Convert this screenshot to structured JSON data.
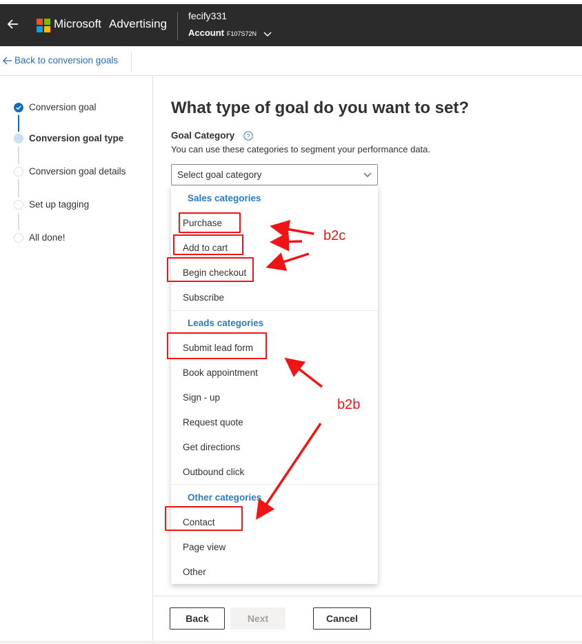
{
  "header": {
    "brand": "Microsoft",
    "product": "Advertising",
    "account_name": "fecify331",
    "account_label": "Account",
    "account_id": "F107S72N",
    "icons": [
      "back-arrow-icon",
      "microsoft-logo-icon",
      "chevron-down-icon"
    ],
    "colors": {
      "bar": "#2b2b2b",
      "logo": [
        "#f25022",
        "#7fba00",
        "#00a4ef",
        "#ffb900"
      ]
    }
  },
  "nav": {
    "back_label": "Back to conversion goals"
  },
  "steps": [
    {
      "label": "Conversion goal",
      "state": "done"
    },
    {
      "label": "Conversion goal type",
      "state": "current"
    },
    {
      "label": "Conversion goal details",
      "state": "pending"
    },
    {
      "label": "Set up tagging",
      "state": "pending"
    },
    {
      "label": "All done!",
      "state": "pending"
    }
  ],
  "main": {
    "title": "What type of goal do you want to set?",
    "category_label": "Goal Category",
    "category_description": "You can use these categories to segment your performance data.",
    "select_placeholder": "Select goal category"
  },
  "dropdown": {
    "groups": [
      {
        "header": "Sales categories",
        "options": [
          "Purchase",
          "Add to cart",
          "Begin checkout",
          "Subscribe"
        ]
      },
      {
        "header": "Leads categories",
        "options": [
          "Submit lead form",
          "Book appointment",
          "Sign - up",
          "Request quote",
          "Get directions",
          "Outbound click"
        ]
      },
      {
        "header": "Other categories",
        "options": [
          "Contact",
          "Page view",
          "Other"
        ]
      }
    ]
  },
  "annotations": {
    "b2c": "b2c",
    "b2b": "b2b",
    "color": "#f01414"
  },
  "footer": {
    "back": "Back",
    "next": "Next",
    "cancel": "Cancel"
  }
}
